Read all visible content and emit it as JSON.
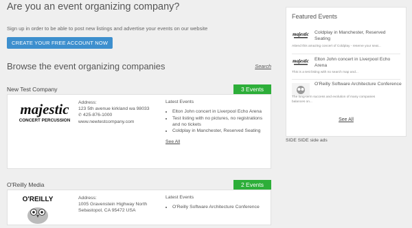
{
  "header": {
    "title": "Are you an event organizing company?",
    "signup_text": "Sign up in order to be able to post new listings and advertise your events on our website",
    "cta_label": "CREATE YOUR FREE ACCOUNT NOW"
  },
  "browse": {
    "title": "Browse the event organizing companies",
    "search_label": "Search"
  },
  "companies": [
    {
      "name": "New Test Company",
      "events_badge": "3 Events",
      "logo_text": "majestic",
      "logo_sub": "CONCERT PERCUSSION",
      "address_label": "Address:",
      "address": "123 5th avenue kirkland wa 98033",
      "phone": "425-876-1000",
      "website": "www.newtestcompany.com",
      "latest_label": "Latest Events",
      "events": [
        "Elton John concert in Liverpool Echo Arena",
        "Test listing with no pictures, no registrations and no tickets",
        "Coldplay in Manchester, Reserved Seating"
      ],
      "see_all": "See All"
    },
    {
      "name": "O'Reilly Media",
      "events_badge": "2 Events",
      "logo_text": "O'REILLY",
      "address_label": "Address:",
      "address_line1": "1005 Gravenstein Highway North",
      "address_line2": "Sebastopol, CA 95472 USA",
      "latest_label": "Latest Events",
      "events": [
        "O'Reilly Software Architecture Conference"
      ]
    }
  ],
  "sidebar": {
    "title": "Featured Events",
    "items": [
      {
        "title": "Coldplay in Manchester, Reserved Seating",
        "desc": "Attend this amazing concert of Coldplay - reserve your seat..."
      },
      {
        "title": "Elton John concert in Liverpool Echo Arena",
        "desc": "This is a test listing with no search map and..."
      },
      {
        "title": "O'Reilly Software Architecture Conference",
        "desc": "The long-term success and evolution of many companies balances on..."
      }
    ],
    "see_all": "See All"
  },
  "side_ads": "SIDE SIDE side ads",
  "colors": {
    "accent": "#3d8fce",
    "badge": "#2dae39"
  },
  "icons": {
    "phone": "phone-icon"
  }
}
